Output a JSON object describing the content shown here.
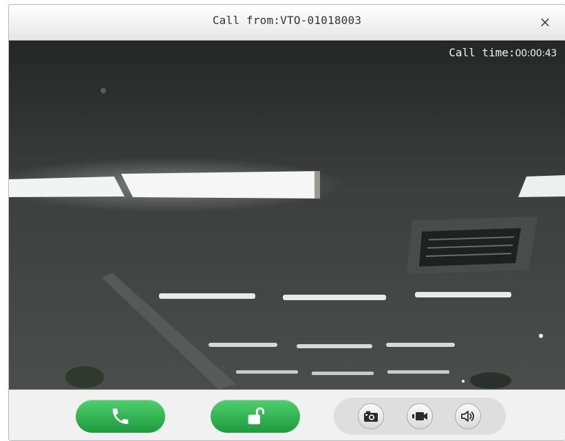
{
  "window": {
    "title": "Call from:VTO-01018003",
    "close_label": "×"
  },
  "video": {
    "call_time_label": "Call time:",
    "call_time_value": "00:00:43"
  },
  "controls": {
    "answer_icon": "phone-icon",
    "unlock_icon": "unlock-icon",
    "tools": [
      {
        "name": "snapshot",
        "icon": "camera-icon"
      },
      {
        "name": "record",
        "icon": "video-camera-icon"
      },
      {
        "name": "volume",
        "icon": "speaker-icon"
      }
    ]
  },
  "colors": {
    "accent_green": "#2fb14f",
    "titlebar": "#eeeeee"
  }
}
